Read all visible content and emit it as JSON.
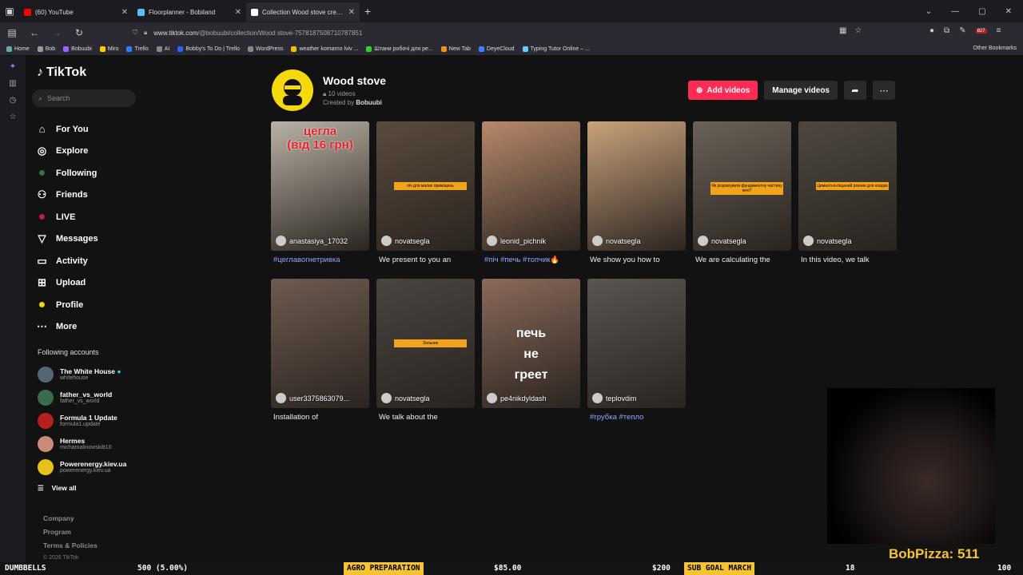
{
  "browser": {
    "tabs": [
      {
        "title": "(60) YouTube",
        "color": "#ff0000",
        "active": false
      },
      {
        "title": "Floorplanner - Bobiland",
        "color": "#4fc3f7",
        "active": false
      },
      {
        "title": "Collection Wood stove created",
        "color": "#ffffff",
        "active": true
      }
    ],
    "url_host": "www.tiktok.com",
    "url_path": "/@bobuubi/collection/Wood stove-7578187508710787851",
    "bookmarks": [
      "Home",
      "Bob",
      "Bobuubi",
      "Miro",
      "Trello",
      "AI",
      "Bobby's To Do | Trello",
      "WordPress",
      "weather komarno lviv ...",
      "Штани робочі для ре...",
      "New Tab",
      "DeyeCloud",
      "Typing Tutor Online – ..."
    ],
    "bookmarks_other": "Other Bookmarks",
    "badge_count": "827"
  },
  "sidebar": {
    "logo": "TikTok",
    "search_placeholder": "Search",
    "nav": [
      {
        "label": "For You",
        "icon": "home-icon"
      },
      {
        "label": "Explore",
        "icon": "compass-icon"
      },
      {
        "label": "Following",
        "icon": "following-avatar-icon"
      },
      {
        "label": "Friends",
        "icon": "friends-icon"
      },
      {
        "label": "LIVE",
        "icon": "live-icon"
      },
      {
        "label": "Messages",
        "icon": "messages-icon"
      },
      {
        "label": "Activity",
        "icon": "activity-icon"
      },
      {
        "label": "Upload",
        "icon": "upload-icon"
      },
      {
        "label": "Profile",
        "icon": "profile-icon"
      },
      {
        "label": "More",
        "icon": "more-icon"
      }
    ],
    "following_heading": "Following accounts",
    "following": [
      {
        "name": "The White House",
        "handle": "whitehouse",
        "verified": true,
        "color": "#556677"
      },
      {
        "name": "father_vs_world",
        "handle": "father_vs_world",
        "verified": false,
        "color": "#3a6b4a"
      },
      {
        "name": "Formula 1 Update",
        "handle": "formula1.update",
        "verified": false,
        "color": "#b52020"
      },
      {
        "name": "Hermes",
        "handle": "michamalinowski810",
        "verified": false,
        "color": "#c98a7a"
      },
      {
        "name": "Powerenergy.kiev.ua",
        "handle": "powerenergy.kiev.ua",
        "verified": false,
        "color": "#e6c21a"
      }
    ],
    "view_all": "View all",
    "footer": [
      "Company",
      "Program",
      "Terms & Policies"
    ],
    "copyright": "© 2026 TikTok"
  },
  "collection": {
    "title": "Wood stove",
    "count": "10 videos",
    "created_by_prefix": "Created by",
    "creator": "Bobuubi",
    "add_videos": "Add videos",
    "manage_videos": "Manage videos"
  },
  "videos": [
    {
      "author": "anastasiya_17032",
      "desc": "#цеглавогнетривка",
      "hashtag": true,
      "bg": "#b9b2a6",
      "overlay_red": "цегла\n(від 16 грн)",
      "tag": "",
      "big": ""
    },
    {
      "author": "novatsegla",
      "desc": "We present to you an",
      "hashtag": false,
      "bg": "#5a4b3c",
      "overlay_red": "",
      "tag": "піч для малих приміщень",
      "big": ""
    },
    {
      "author": "leonid_pichnik",
      "desc": "#піч #печь #топчик🔥",
      "hashtag": true,
      "bg": "#b8896a",
      "overlay_red": "",
      "tag": "",
      "big": ""
    },
    {
      "author": "novatsegla",
      "desc": "We show you how to",
      "hashtag": false,
      "bg": "#c9a27a",
      "overlay_red": "",
      "tag": "",
      "big": ""
    },
    {
      "author": "novatsegla",
      "desc": "We are calculating the",
      "hashtag": false,
      "bg": "#6a6258",
      "overlay_red": "",
      "tag": "Як розрахувати фундаментну частину печі?",
      "big": ""
    },
    {
      "author": "novatsegla",
      "desc": "In this video, we talk",
      "hashtag": false,
      "bg": "#4e4840",
      "overlay_red": "",
      "tag": "Цементно-піщаний розчин для кладки",
      "big": ""
    },
    {
      "author": "user3375863079...",
      "desc": "Installation of",
      "hashtag": false,
      "bg": "#6e5a50",
      "overlay_red": "",
      "tag": "",
      "big": ""
    },
    {
      "author": "novatsegla",
      "desc": "We talk about the",
      "hashtag": false,
      "bg": "#4a4540",
      "overlay_red": "",
      "tag": "Зольник",
      "big": ""
    },
    {
      "author": "pe4nikdyldash",
      "desc": "",
      "hashtag": false,
      "bg": "#8a6a5a",
      "overlay_red": "",
      "tag": "",
      "big": "печь\nне\nгреет"
    },
    {
      "author": "teplovdim",
      "desc": "#грубка #тепло",
      "hashtag": true,
      "bg": "#5a5550",
      "overlay_red": "",
      "tag": "",
      "big": ""
    }
  ],
  "stream": {
    "name": "BobPizza: 511",
    "ticker": [
      "DUMBBELLS",
      "500 (5.00%)",
      "AGRO PREPARATION",
      "$85.00",
      "$200",
      "SUB GOAL MARCH",
      "18",
      "100"
    ]
  }
}
